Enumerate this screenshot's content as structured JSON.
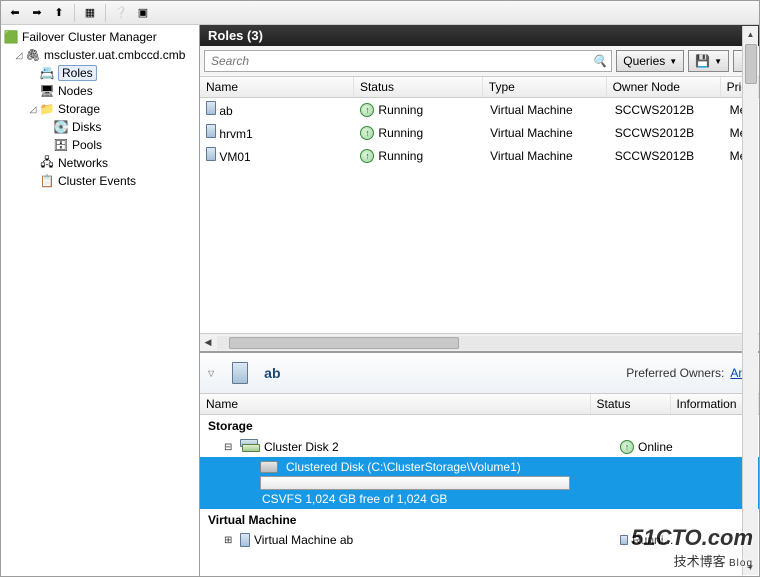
{
  "toolbar_icons": [
    "←",
    "→",
    "↑",
    "▦",
    "?",
    "▣"
  ],
  "tree": {
    "root_label": "Failover Cluster Manager",
    "cluster_label": "mscluster.uat.cmbccd.cmb",
    "items": [
      {
        "label": "Roles",
        "selected": true
      },
      {
        "label": "Nodes",
        "selected": false
      },
      {
        "label": "Storage",
        "children": [
          "Disks",
          "Pools"
        ]
      },
      {
        "label": "Networks",
        "selected": false
      },
      {
        "label": "Cluster Events",
        "selected": false
      }
    ]
  },
  "roles_header": "Roles (3)",
  "search": {
    "placeholder": "Search"
  },
  "queries_label": "Queries",
  "columns": [
    "Name",
    "Status",
    "Type",
    "Owner Node",
    "Prior"
  ],
  "rows": [
    {
      "name": "ab",
      "status": "Running",
      "type": "Virtual Machine",
      "owner": "SCCWS2012B",
      "prio": "Med"
    },
    {
      "name": "hrvm1",
      "status": "Running",
      "type": "Virtual Machine",
      "owner": "SCCWS2012B",
      "prio": "Med"
    },
    {
      "name": "VM01",
      "status": "Running",
      "type": "Virtual Machine",
      "owner": "SCCWS2012B",
      "prio": "Med"
    }
  ],
  "detail": {
    "title": "ab",
    "pref_owners_label": "Preferred Owners:",
    "pref_owners_value": "Any",
    "columns": [
      "Name",
      "Status",
      "Information"
    ],
    "group_storage": "Storage",
    "cluster_disk": "Cluster Disk 2",
    "cluster_disk_status": "Online",
    "clustered_disk_line": "Clustered Disk (C:\\ClusterStorage\\Volume1)",
    "csv_line": "CSVFS 1,024 GB free of 1,024 GB",
    "group_vm": "Virtual Machine",
    "vm_name": "Virtual Machine ab",
    "vm_status": "Runni..."
  },
  "watermark": {
    "line1": "51CTO.com",
    "line2": "技术博客",
    "tag": "Blog"
  }
}
